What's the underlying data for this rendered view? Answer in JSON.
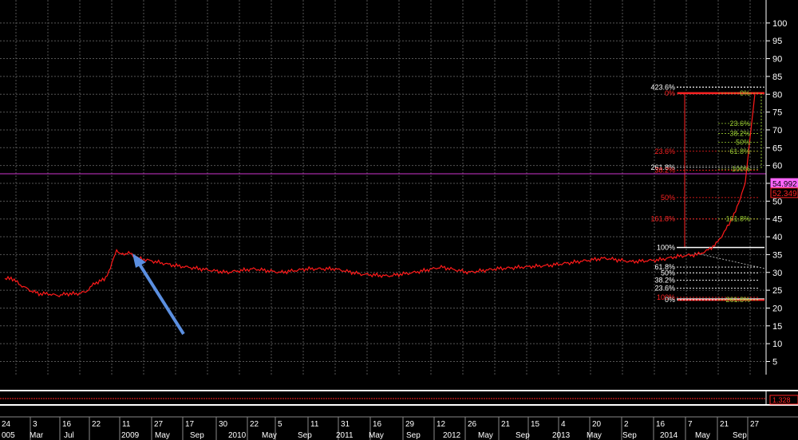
{
  "chart_data": {
    "type": "line",
    "title": "",
    "xlabel": "",
    "ylabel": "",
    "ylim": [
      0,
      100
    ],
    "y_ticks": [
      5,
      10,
      15,
      20,
      25,
      30,
      35,
      40,
      45,
      50,
      55,
      60,
      65,
      70,
      75,
      80,
      85,
      90,
      95,
      100
    ],
    "grid": true,
    "series": [
      {
        "color": "#ff1a1a",
        "x": [
          "2005-12",
          "2006-02",
          "2006-05",
          "2006-08",
          "2006-11",
          "2007-02",
          "2007-05",
          "2007-08",
          "2007-11",
          "2008-02",
          "2008-05",
          "2008-08",
          "2008-10",
          "2008-11",
          "2008-12",
          "2009-01",
          "2009-02",
          "2009-03",
          "2009-05",
          "2009-07",
          "2009-10",
          "2010-01",
          "2010-04",
          "2010-07",
          "2010-10",
          "2011-01",
          "2011-04",
          "2011-07",
          "2011-10",
          "2012-01",
          "2012-04",
          "2012-07",
          "2012-10",
          "2013-01",
          "2013-04",
          "2013-07",
          "2013-10",
          "2014-01",
          "2014-03",
          "2014-05",
          "2014-06",
          "2014-07",
          "2014-08",
          "2014-09",
          "2014-10",
          "2014-11"
        ],
        "values": [
          28,
          28.5,
          26.5,
          25,
          24,
          24,
          23.5,
          24,
          24,
          24.5,
          27,
          28,
          31,
          34,
          36.5,
          35,
          35.5,
          34,
          33,
          32,
          31,
          30,
          31,
          30,
          31,
          31,
          29.5,
          29,
          30,
          31.5,
          30,
          31,
          31.5,
          32,
          33,
          34,
          33,
          33.5,
          34.5,
          35,
          36,
          38,
          42,
          47,
          55,
          80
        ]
      }
    ],
    "current_price_line": 54.99,
    "price_labels": [
      {
        "text": "54.992",
        "color": "#ff66ff"
      },
      {
        "text": "52.349",
        "color": "#ff2222"
      }
    ],
    "fib_left": [
      {
        "text": "423.6%",
        "value": 82,
        "color": "#ffffff"
      },
      {
        "text": "0%",
        "value": 80.3,
        "color": "#ff2222"
      },
      {
        "text": "23.6%",
        "value": 64,
        "color": "#ff2222"
      },
      {
        "text": "261.8%",
        "value": 59.5,
        "color": "#ffffff"
      },
      {
        "text": "38.2%",
        "value": 58.7,
        "color": "#ff2222"
      },
      {
        "text": "50%",
        "value": 51,
        "color": "#ff2222"
      },
      {
        "text": "161.8%",
        "value": 45,
        "color": "#ff2222"
      },
      {
        "text": "100%",
        "value": 37,
        "color": "#ffffff"
      },
      {
        "text": "61.8%",
        "value": 31.5,
        "color": "#ffffff"
      },
      {
        "text": "50%",
        "value": 29.8,
        "color": "#ffffff"
      },
      {
        "text": "38.2%",
        "value": 27.8,
        "color": "#ffffff"
      },
      {
        "text": "23.6%",
        "value": 25.6,
        "color": "#ffffff"
      },
      {
        "text": "100%",
        "value": 23,
        "color": "#ff2222"
      },
      {
        "text": "0%",
        "value": 22.3,
        "color": "#ffffff"
      }
    ],
    "fib_right": [
      {
        "text": "0%",
        "value": 80.3
      },
      {
        "text": "23.6%",
        "value": 71.8
      },
      {
        "text": "38.2%",
        "value": 69
      },
      {
        "text": "50%",
        "value": 66.5
      },
      {
        "text": "61.8%",
        "value": 64
      },
      {
        "text": "100%",
        "value": 59
      },
      {
        "text": "161.8%",
        "value": 45
      },
      {
        "text": "261.8%",
        "value": 22.3
      }
    ],
    "indicator_label": "1.328",
    "x_axis_days": [
      {
        "text": "24",
        "x": 2
      },
      {
        "text": "3",
        "x": 41
      },
      {
        "text": "16",
        "x": 78
      },
      {
        "text": "22",
        "x": 115
      },
      {
        "text": "11",
        "x": 153
      },
      {
        "text": "27",
        "x": 193
      },
      {
        "text": "17",
        "x": 232
      },
      {
        "text": "30",
        "x": 274
      },
      {
        "text": "22",
        "x": 313
      },
      {
        "text": "5",
        "x": 348
      },
      {
        "text": "11",
        "x": 389
      },
      {
        "text": "31",
        "x": 427
      },
      {
        "text": "16",
        "x": 467
      },
      {
        "text": "29",
        "x": 508
      },
      {
        "text": "12",
        "x": 547
      },
      {
        "text": "26",
        "x": 586
      },
      {
        "text": "21",
        "x": 628
      },
      {
        "text": "15",
        "x": 665
      },
      {
        "text": "4",
        "x": 703
      },
      {
        "text": "20",
        "x": 742
      },
      {
        "text": "2",
        "x": 782
      },
      {
        "text": "16",
        "x": 822
      },
      {
        "text": "7",
        "x": 862
      },
      {
        "text": "21",
        "x": 902
      },
      {
        "text": "27",
        "x": 940
      }
    ],
    "x_axis_months": [
      {
        "text": "005",
        "x": 2
      },
      {
        "text": "Mar",
        "x": 37
      },
      {
        "text": "Jul",
        "x": 80
      },
      {
        "text": "2009",
        "x": 152
      },
      {
        "text": "May",
        "x": 194
      },
      {
        "text": "Sep",
        "x": 238
      },
      {
        "text": "2010",
        "x": 286
      },
      {
        "text": "May",
        "x": 328
      },
      {
        "text": "Sep",
        "x": 373
      },
      {
        "text": "2011",
        "x": 421
      },
      {
        "text": "May",
        "x": 462
      },
      {
        "text": "Sep",
        "x": 509
      },
      {
        "text": "2012",
        "x": 555
      },
      {
        "text": "May",
        "x": 599
      },
      {
        "text": "Sep",
        "x": 646
      },
      {
        "text": "2013",
        "x": 692
      },
      {
        "text": "May",
        "x": 735
      },
      {
        "text": "Sep",
        "x": 780
      },
      {
        "text": "2014",
        "x": 827
      },
      {
        "text": "May",
        "x": 871
      },
      {
        "text": "Sep",
        "x": 918
      }
    ]
  }
}
